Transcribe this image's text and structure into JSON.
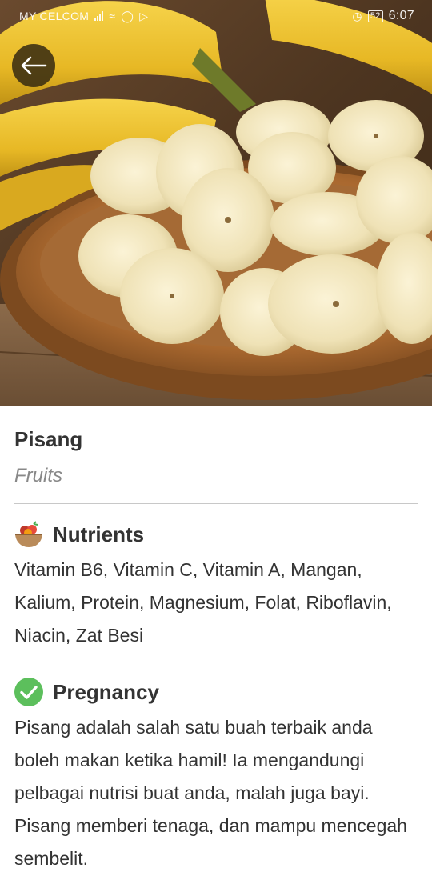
{
  "status_bar": {
    "carrier": "MY CELCOM",
    "battery": "52",
    "time": "6:07"
  },
  "hero": {
    "image_icon": "banana-slices-photo"
  },
  "back_button": {
    "icon": "arrow-left-icon"
  },
  "food": {
    "name": "Pisang",
    "category": "Fruits"
  },
  "nutrients": {
    "icon": "fruit-bowl-icon",
    "title": "Nutrients",
    "text": "Vitamin B6, Vitamin C, Vitamin A, Mangan, Kalium, Protein, Magnesium, Folat, Riboflavin, Niacin, Zat Besi"
  },
  "pregnancy": {
    "icon": "check-circle-icon",
    "title": "Pregnancy",
    "status_color": "#5cbf5c",
    "text": "Pisang adalah salah satu buah terbaik anda boleh makan ketika hamil! Ia mengandungi pelbagai nutrisi buat anda, malah juga bayi. Pisang memberi tenaga, dan mampu mencegah sembelit."
  }
}
